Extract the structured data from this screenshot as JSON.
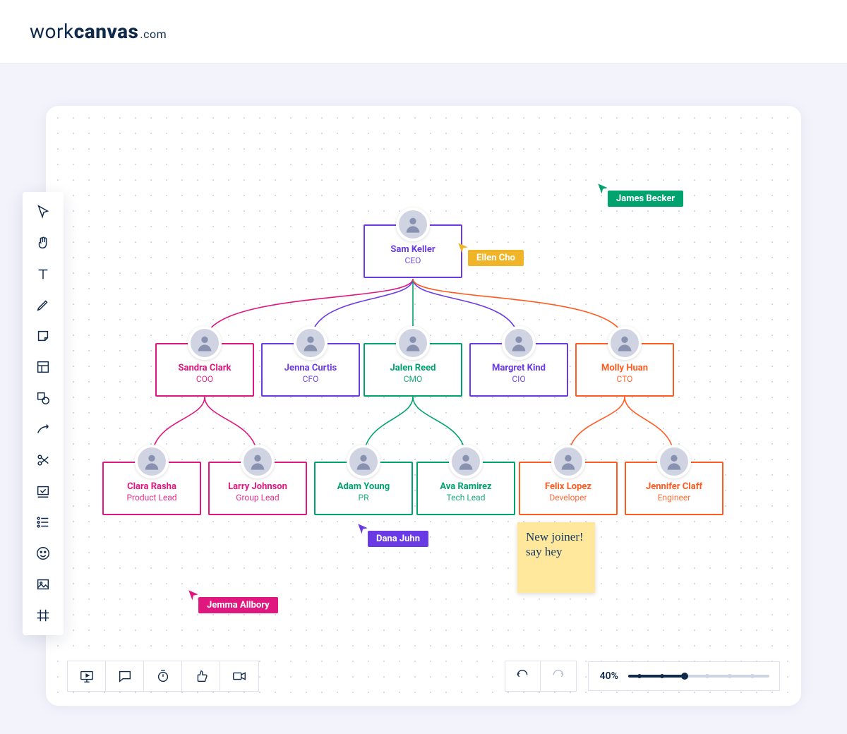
{
  "brand": {
    "part1": "work",
    "part2": "canvas",
    "suffix": ".com"
  },
  "colors": {
    "purple": "#6a3ae4",
    "magenta": "#e0177e",
    "green": "#00a36d",
    "orange": "#ff5a1f",
    "yellow": "#f0b429",
    "navy": "#0f2a4a"
  },
  "org": {
    "ceo": {
      "name": "Sam Keller",
      "role": "CEO",
      "color": "purple"
    },
    "coo": {
      "name": "Sandra Clark",
      "role": "COO",
      "color": "magenta"
    },
    "cfo": {
      "name": "Jenna Curtis",
      "role": "CFO",
      "color": "purple"
    },
    "cmo": {
      "name": "Jalen Reed",
      "role": "CMO",
      "color": "green"
    },
    "cio": {
      "name": "Margret Kind",
      "role": "CIO",
      "color": "purple"
    },
    "cto": {
      "name": "Molly Huan",
      "role": "CTO",
      "color": "orange"
    },
    "pl": {
      "name": "Clara Rasha",
      "role": "Product Lead",
      "color": "magenta"
    },
    "gl": {
      "name": "Larry Johnson",
      "role": "Group Lead",
      "color": "magenta"
    },
    "pr": {
      "name": "Adam Young",
      "role": "PR",
      "color": "green"
    },
    "tl": {
      "name": "Ava Ramirez",
      "role": "Tech Lead",
      "color": "green"
    },
    "dev": {
      "name": "Felix Lopez",
      "role": "Developer",
      "color": "orange"
    },
    "eng": {
      "name": "Jennifer Claff",
      "role": "Engineer",
      "color": "orange"
    }
  },
  "sticky": {
    "text": "New joiner! say hey"
  },
  "collaborators": {
    "james": {
      "label": "James Becker",
      "color": "green"
    },
    "ellen": {
      "label": "Ellen Cho",
      "color": "yellow"
    },
    "dana": {
      "label": "Dana Juhn",
      "color": "purple"
    },
    "jemma": {
      "label": "Jemma Allbory",
      "color": "magenta"
    }
  },
  "zoom": {
    "label": "40%",
    "percent": 40
  }
}
